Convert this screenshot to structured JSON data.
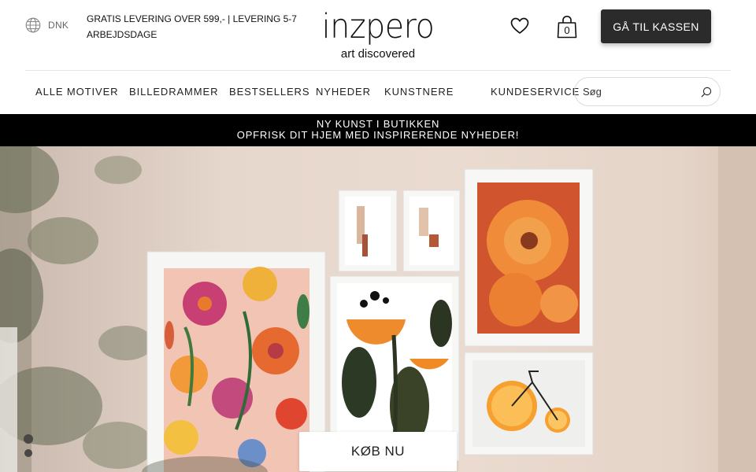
{
  "header": {
    "language_code": "DNK",
    "shipping_notice": "GRATIS LEVERING OVER 599,- | LEVERING 5-7 ARBEJDSDAGE",
    "logo_text": "inzpero",
    "logo_tagline": "art discovered",
    "cart_count": "0",
    "checkout_label": "GÅ TIL KASSEN",
    "icons": {
      "language": "globe-icon",
      "favorites": "heart-icon",
      "cart": "shopping-bag-icon",
      "search": "search-icon"
    }
  },
  "nav": {
    "items": [
      {
        "label": "ALLE MOTIVER"
      },
      {
        "label": "BILLEDRAMMER"
      },
      {
        "label": "BESTSELLERS"
      },
      {
        "label": "NYHEDER"
      },
      {
        "label": "KUNSTNERE"
      },
      {
        "label": "KUNDESERVICE"
      }
    ],
    "search_placeholder": "Søg"
  },
  "banner": {
    "line1": "NY KUNST I BUTIKKEN",
    "line2": "OPFRISK DIT HJEM MED INSPIRERENDE NYHEDER!"
  },
  "hero": {
    "cta_label": "KØB NU"
  },
  "colors": {
    "checkout_bg": "#2b2b2b",
    "banner_bg": "#000000",
    "wall": "#e6d7cc"
  }
}
